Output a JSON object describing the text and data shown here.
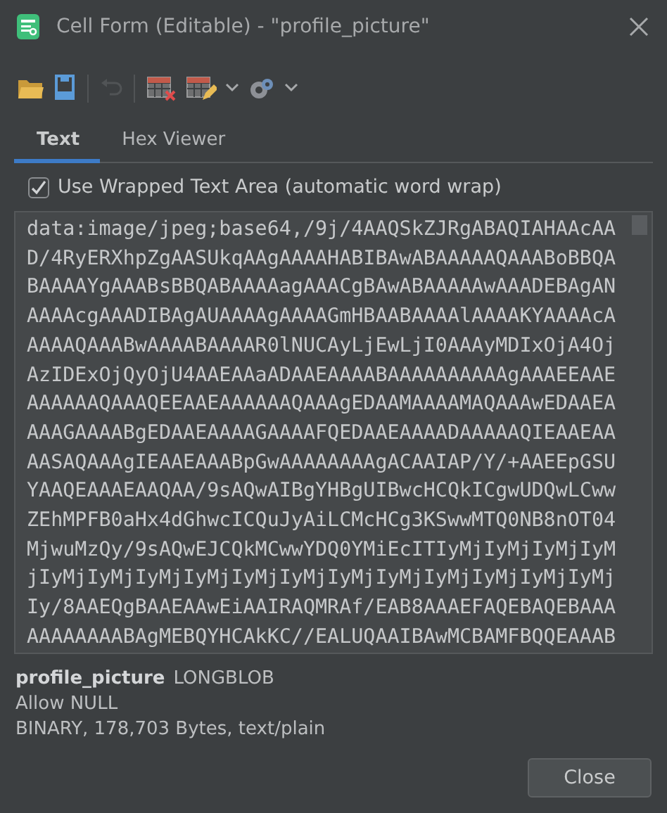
{
  "window": {
    "title": "Cell Form (Editable) - \"profile_picture\""
  },
  "toolbar": [
    {
      "kind": "open",
      "disabled": false
    },
    {
      "kind": "save",
      "disabled": false
    },
    {
      "kind": "separator"
    },
    {
      "kind": "undo",
      "disabled": true
    },
    {
      "kind": "separator"
    },
    {
      "kind": "clear",
      "disabled": false
    },
    {
      "kind": "edit",
      "disabled": false
    },
    {
      "kind": "dropdown",
      "disabled": false
    },
    {
      "kind": "transform",
      "disabled": false
    },
    {
      "kind": "dropdown",
      "disabled": false
    }
  ],
  "tabs": [
    {
      "label": "Text",
      "selected": true
    },
    {
      "label": "Hex Viewer",
      "selected": false
    }
  ],
  "wrap_option": {
    "label": "Use Wrapped Text Area (automatic word wrap)",
    "checked": true
  },
  "editor": {
    "lines": [
      "data:image/jpeg;base64,/9j/4AAQSkZJRgABAQIAHAAcAA",
      "D/4RyERXhpZgAASUkqAAgAAAAHABIBAwABAAAAAQAAABoBBQA",
      "BAAAAYgAAABsBBQABAAAAagAAACgBAwABAAAAAwAAADEBAgAN",
      "AAAAcgAAADIBAgAUAAAAgAAAAGmHBAABAAAAlAAAAKYAAAAcA",
      "AAAAQAAABwAAAABAAAAR0lNUCAyLjEwLjI0AAAyMDIxOjA4Oj",
      "AzIDExOjQyOjU4AAEAAaADAAEAAAABAAAAAAAAAAgAAAEEAAE",
      "AAAAAAQAAAQEEAAEAAAAAAQAAAgEDAAMAAAAMAQAAAwEDAAEA",
      "AAAGAAAABgEDAAEAAAAGAAAAFQEDAAEAAAADAAAAAQIEAAEAA",
      "AASAQAAAgIEAAEAAABpGwAAAAAAAAgACAAIAP/Y/+AAEEpGSU",
      "YAAQEAAAEAAQAA/9sAQwAIBgYHBgUIBwcHCQkICgwUDQwLCww",
      "ZEhMPFB0aHx4dGhwcICQuJyAiLCMcHCg3KSwwMTQ0NB8nOT04",
      "MjwuMzQy/9sAQwEJCQkMCwwYDQ0YMiEcITIyMjIyMjIyMjIyM",
      "jIyMjIyMjIyMjIyMjIyMjIyMjIyMjIyMjIyMjIyMjIyMjIyMj",
      "Iy/8AAEQgBAAEAAwEiAAIRAQMRAf/EAB8AAAEFAQEBAQEBAAA",
      "AAAAAAAABAgMEBQYHCAkKC//EALUQAAIBAwMCBAMFBQQEAAAB"
    ]
  },
  "column_info": {
    "name": "profile_picture",
    "type": "LONGBLOB",
    "nullability": "Allow NULL",
    "details": "BINARY, 178,703 Bytes, text/plain"
  },
  "buttons": [
    "Close"
  ]
}
